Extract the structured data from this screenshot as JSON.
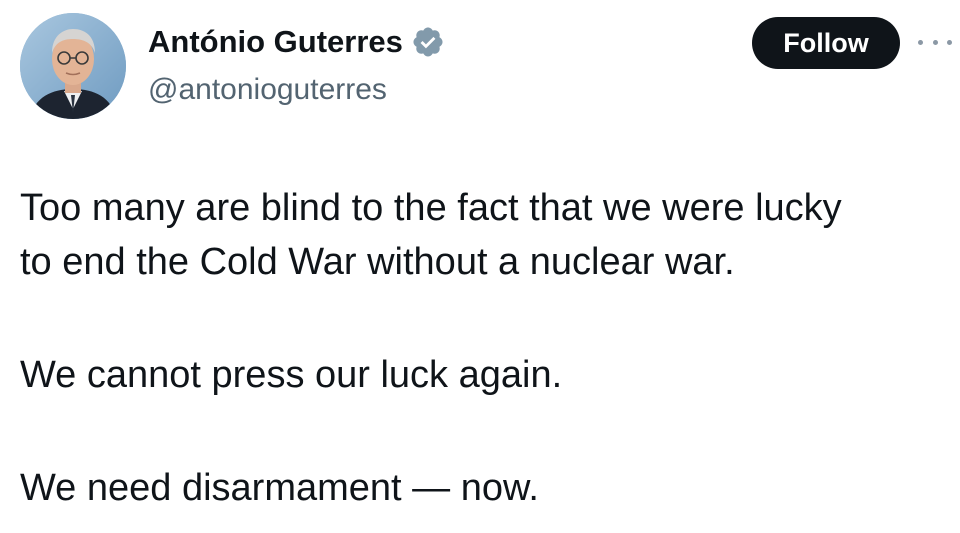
{
  "author": {
    "display_name": "António Guterres",
    "handle": "@antonioguterres",
    "verified": true,
    "avatar_icon": "profile-photo"
  },
  "actions": {
    "follow_label": "Follow",
    "more_icon": "ellipsis-icon"
  },
  "tweet": {
    "line_1": "Too many are blind to the fact that we were lucky",
    "line_2": "to end the Cold War without a nuclear war.",
    "line_3": "We cannot press our luck again.",
    "line_4": "We need disarmament — now."
  },
  "colors": {
    "text_primary": "#0f1419",
    "text_secondary": "#536471",
    "follow_bg": "#0f1419",
    "follow_text": "#ffffff",
    "verified_badge": "#829aab"
  }
}
